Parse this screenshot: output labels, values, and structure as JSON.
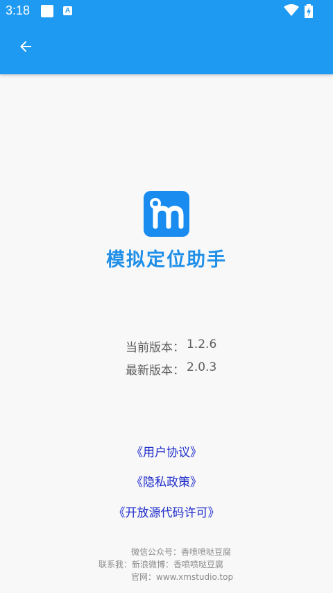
{
  "status_bar": {
    "time": "3:18",
    "notification_icons": [
      "blank-square-icon",
      "a-app-icon"
    ],
    "system_icons": [
      "wifi-icon",
      "battery-icon"
    ],
    "notification_letter": "A"
  },
  "app_bar": {
    "back_icon": "arrow-back-icon",
    "color": "#1f9af2"
  },
  "app": {
    "icon": "m-location-logo-icon",
    "title": "模拟定位助手"
  },
  "version": {
    "current_label": "当前版本：",
    "current_value": "1.2.6",
    "latest_label": "最新版本：",
    "latest_value": "2.0.3"
  },
  "links": {
    "user_agreement": "《用户协议》",
    "privacy_policy": "《隐私政策》",
    "open_source": "《开放源代码许可》",
    "color": "#1d2bcc"
  },
  "footer": {
    "wechat": "微信公众号：香喷喷哒豆腐",
    "weibo": "联系我：新浪微博：香喷喷哒豆腐",
    "website": "官网：www.xmstudio.top"
  }
}
